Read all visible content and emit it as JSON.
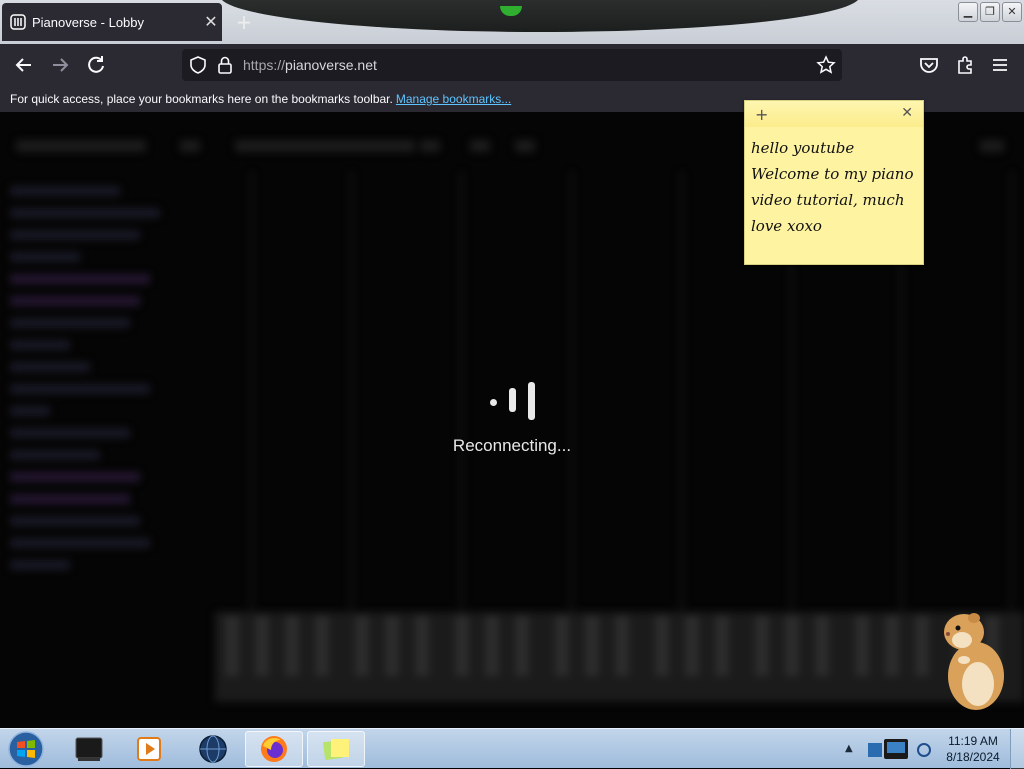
{
  "browser": {
    "tab_title": "Pianoverse - Lobby",
    "url_scheme": "https://",
    "url_host": "pianoverse.net",
    "bookmarks_message": "For quick access, place your bookmarks here on the bookmarks toolbar.",
    "bookmarks_link": "Manage bookmarks..."
  },
  "page": {
    "status_text": "Reconnecting..."
  },
  "sticky_note": {
    "text": "hello youtube Welcome to my piano video tutorial, much love xoxo"
  },
  "taskbar": {
    "items": [
      {
        "name": "terminal-app",
        "icon": "dark-window-icon"
      },
      {
        "name": "media-player-app",
        "icon": "media-player-icon"
      },
      {
        "name": "globe-app",
        "icon": "globe-icon"
      },
      {
        "name": "firefox-app",
        "icon": "firefox-icon",
        "active": true
      },
      {
        "name": "sticky-notes-app",
        "icon": "sticky-notes-icon",
        "active": true
      }
    ],
    "clock_time": "11:19 AM",
    "clock_date": "8/18/2024"
  },
  "colors": {
    "browser_chrome": "#2b2a33",
    "link": "#5ec4ff",
    "sticky": "#fdf3a1",
    "taskbar": "#b3cbe6"
  }
}
